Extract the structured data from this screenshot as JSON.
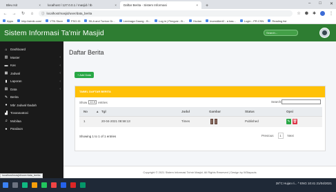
{
  "browser": {
    "tabs": [
      {
        "label": "Bleu Isit",
        "active": false
      },
      {
        "label": "localhost / 127.0.0.1 / masjid / tb",
        "active": false
      },
      {
        "label": "Daftar Berita - Sistem Informasi",
        "active": true
      }
    ],
    "new_tab": "+",
    "url": "localhost/masjid/user/data_berita",
    "bookmarks": [
      "Apps",
      "http://stmik.com/",
      "YTN Store",
      "PSG.ID",
      "SILA and Tuntun Gr...",
      "Lembaga Gaung - B...",
      "Log in | Penguiz - B...",
      "Hudan",
      "InvestAlert2 - a bas...",
      "Login - PR.CSN",
      "Reading list"
    ]
  },
  "header": {
    "title": "Sistem Informasi Ta'mir Masjid",
    "search_placeholder": "Search..."
  },
  "sidebar": {
    "items": [
      {
        "label": "Dashboard",
        "icon": "home-icon",
        "chevron": false
      },
      {
        "label": "Master",
        "icon": "bar-chart-icon",
        "chevron": true
      },
      {
        "label": "Kas",
        "icon": "folder-icon",
        "chevron": true
      },
      {
        "label": "Jadwal",
        "icon": "calendar-icon",
        "chevron": true
      },
      {
        "label": "Laporan",
        "icon": "file-icon",
        "chevron": true
      },
      {
        "label": "Data",
        "icon": "table-icon",
        "chevron": true
      },
      {
        "label": "Berita",
        "icon": "star-icon",
        "chevron": false
      },
      {
        "label": "Mbr Jadwal Ibadah",
        "icon": "info-icon",
        "chevron": false
      },
      {
        "label": "Tovanavatoci",
        "icon": "chart-icon",
        "chevron": false
      },
      {
        "label": "Mobilaa",
        "icon": "music-icon",
        "chevron": false
      },
      {
        "label": "Pandaon",
        "icon": "bell-icon",
        "chevron": false
      }
    ]
  },
  "main": {
    "page_title": "Daftar Berita",
    "add_button": "+ Add Data",
    "card_title": "TABEL DAFTAR BERITA",
    "show_label": "Show",
    "show_value": "10",
    "entries_label": "entries",
    "search_label": "Search:",
    "columns": [
      "No",
      "Tgl",
      "Judul",
      "Gambar",
      "Status",
      "Opsi"
    ],
    "rows": [
      {
        "no": "1",
        "tgl": "20-04-2021 08:58:13",
        "judul": "Times",
        "status": "Published"
      }
    ],
    "info": "Showing 1 to 1 of 1 entries",
    "pager": {
      "previous": "Previous",
      "page": "1",
      "next": "Next"
    }
  },
  "footer": "Copyright © 2021 Sistem Informasi Ta'mir Masjid. All Rights Reserved | Design by W3layouts",
  "status_url": "localhost/masjid/user/data_berita",
  "taskbar": {
    "tray_text": "28°C Hujan ri...  ^  ENG  10:41  21/04/2021"
  },
  "colors": {
    "header_green": "#2e7d32",
    "sidebar_bg": "#1a1a1a",
    "card_header": "#ffc107",
    "add_button": "#28a745",
    "edit_button": "#28a745",
    "delete_button": "#dc3545"
  }
}
